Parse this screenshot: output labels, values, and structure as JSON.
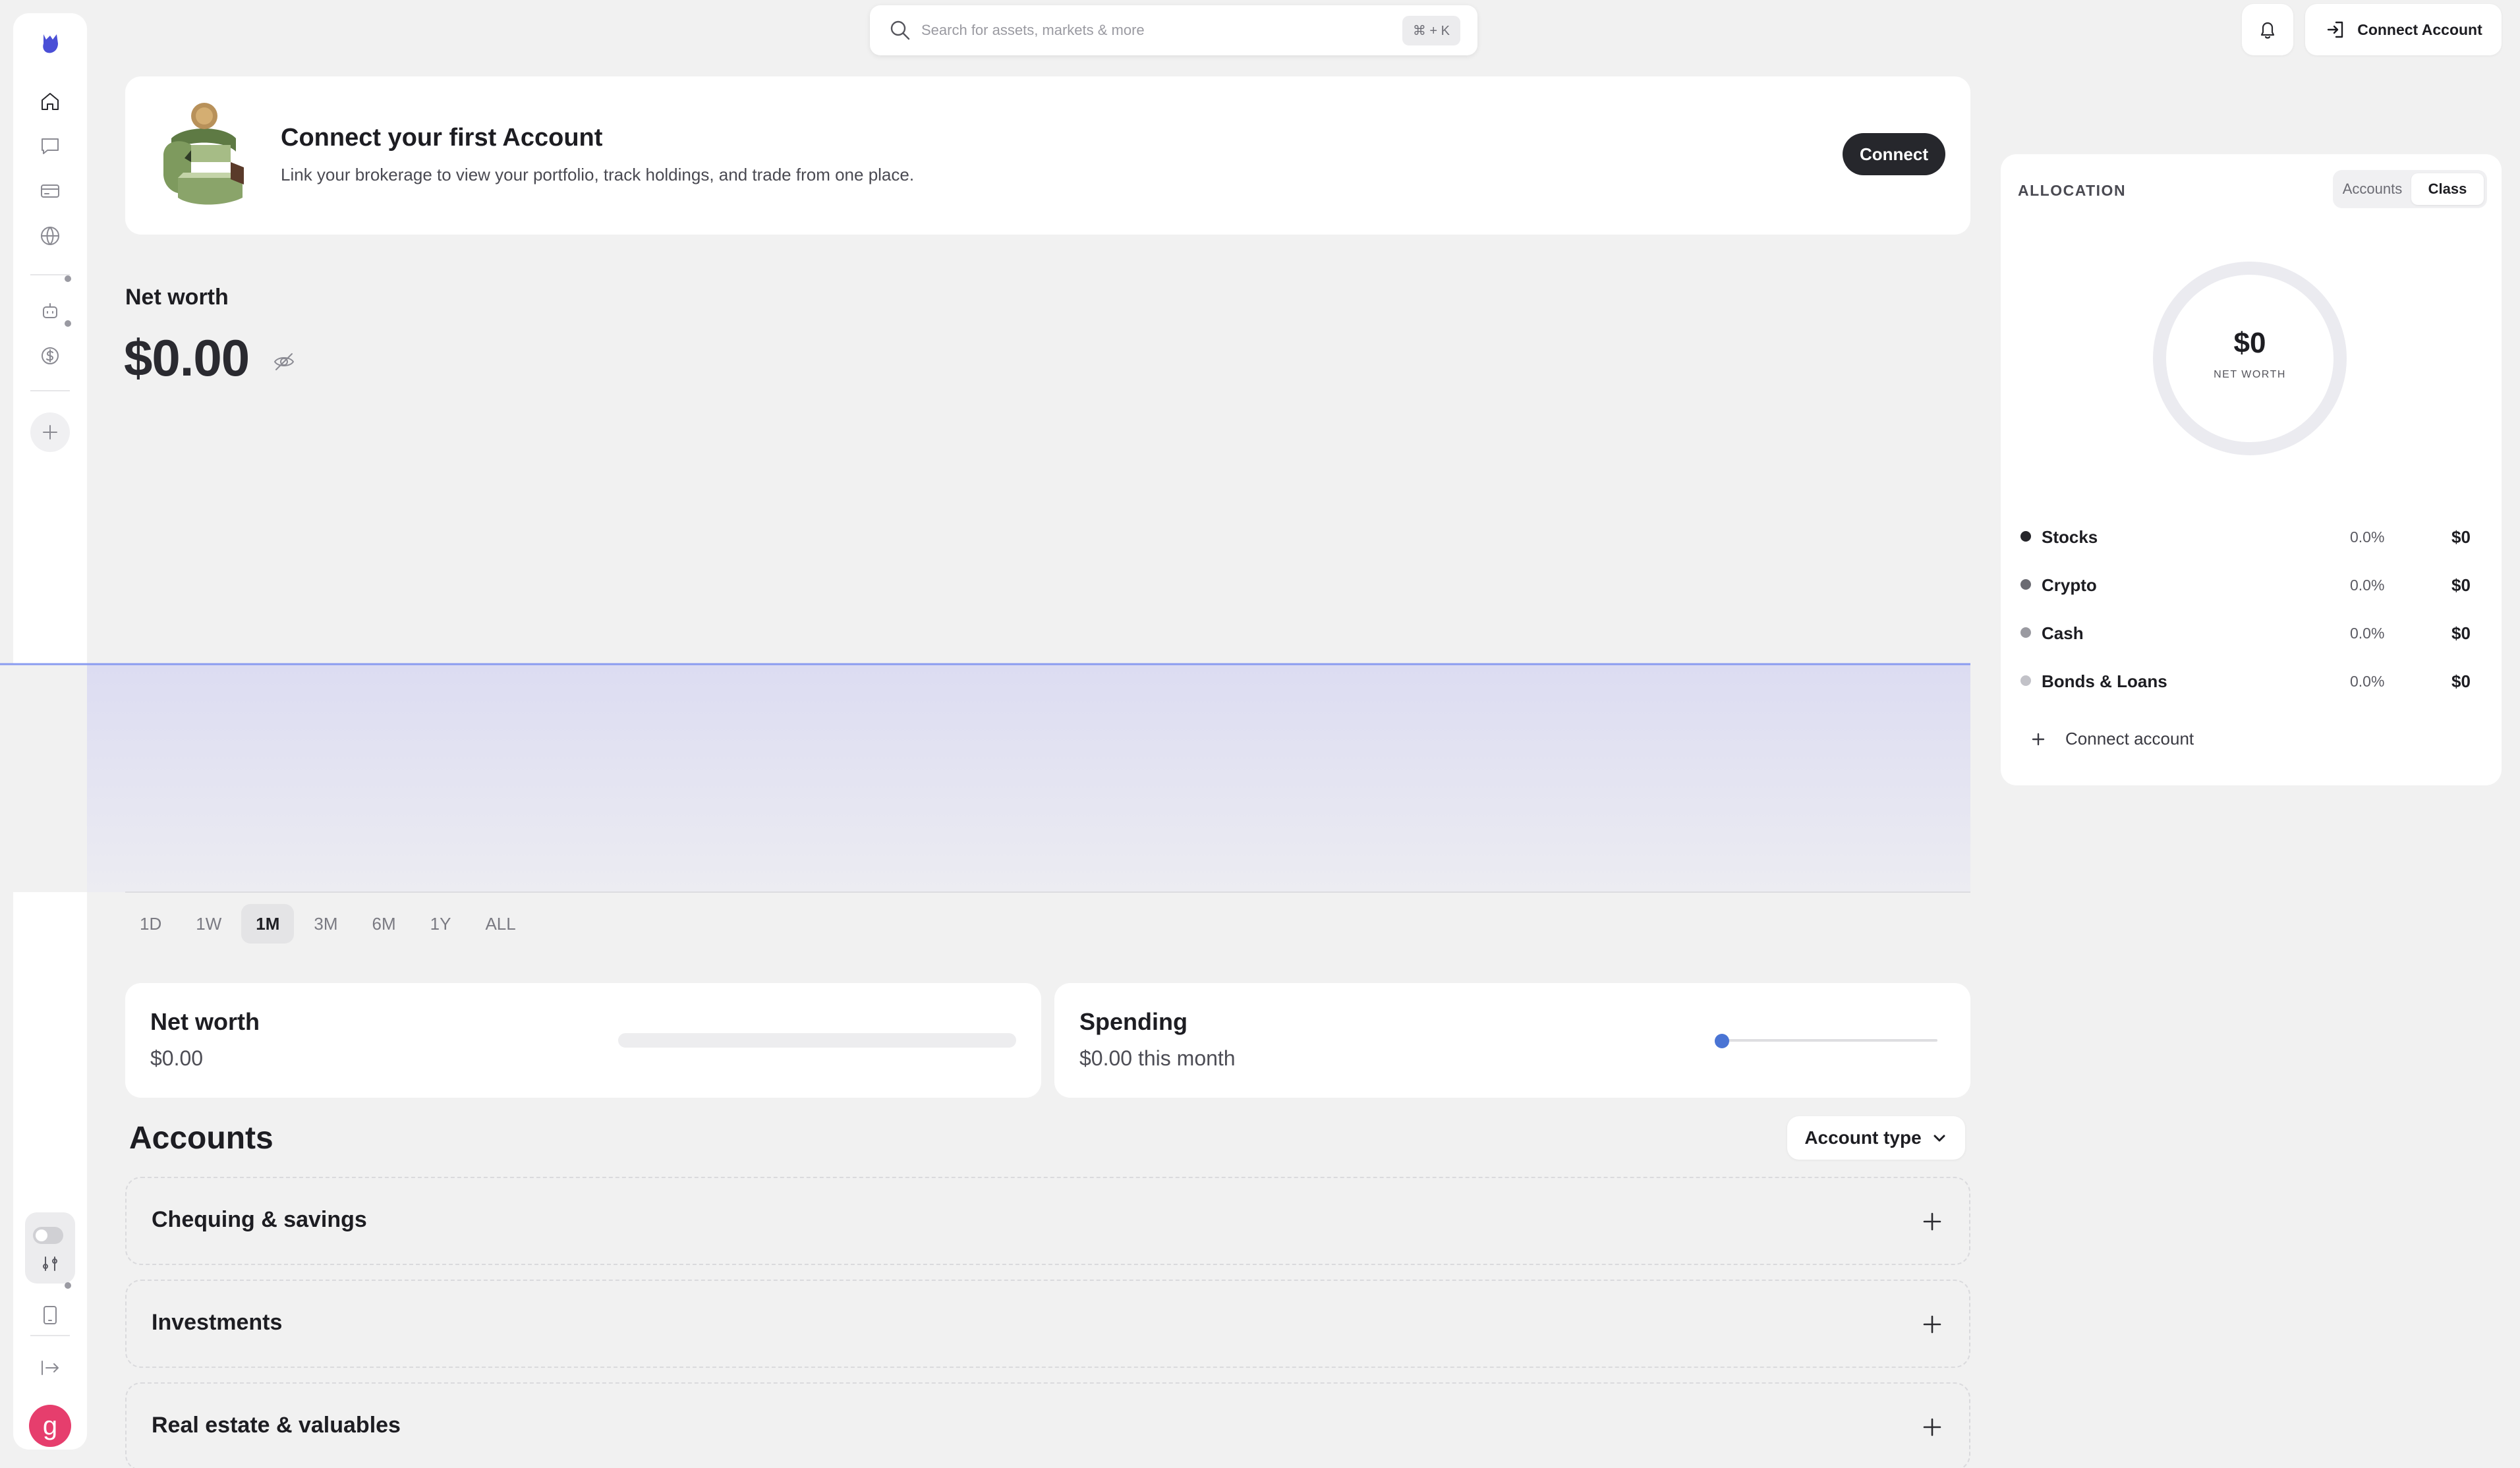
{
  "sidebar": {
    "icons": [
      "logo-icon",
      "home-icon",
      "chat-icon",
      "card-icon",
      "globe-icon",
      "bot-icon",
      "dollar-icon",
      "add-icon",
      "theme-toggle",
      "sliders-icon",
      "tablet-icon",
      "logout-icon"
    ],
    "avatar_letter": "g",
    "avatar_color": "#e63e6d"
  },
  "topbar": {
    "search_placeholder": "Search for assets, markets & more",
    "search_shortcut": "⌘ + K",
    "connect_label": "Connect Account"
  },
  "banner": {
    "title": "Connect your first Account",
    "description": "Link your brokerage to view your portfolio, track holdings, and trade from one place.",
    "button": "Connect"
  },
  "networth": {
    "label": "Net worth",
    "value": "$0.00",
    "line_color": "#8a9cf0"
  },
  "ranges": [
    {
      "label": "1D",
      "active": false
    },
    {
      "label": "1W",
      "active": false
    },
    {
      "label": "1M",
      "active": true
    },
    {
      "label": "3M",
      "active": false
    },
    {
      "label": "6M",
      "active": false
    },
    {
      "label": "1Y",
      "active": false
    },
    {
      "label": "ALL",
      "active": false
    }
  ],
  "cards": {
    "networth": {
      "title": "Net worth",
      "value": "$0.00",
      "bar_fill": 0
    },
    "spending": {
      "title": "Spending",
      "value": "$0.00 this month",
      "slider_position": 0
    }
  },
  "accounts": {
    "title": "Accounts",
    "filter_label": "Account type",
    "groups": [
      "Chequing & savings",
      "Investments",
      "Real estate & valuables"
    ]
  },
  "allocation": {
    "title": "ALLOCATION",
    "tabs": [
      {
        "label": "Accounts",
        "active": false
      },
      {
        "label": "Class",
        "active": true
      }
    ],
    "total": "$0",
    "total_label": "NET WORTH",
    "rows": [
      {
        "name": "Stocks",
        "pct": "0.0%",
        "amount": "$0",
        "color": "#26262b"
      },
      {
        "name": "Crypto",
        "pct": "0.0%",
        "amount": "$0",
        "color": "#6b6b72"
      },
      {
        "name": "Cash",
        "pct": "0.0%",
        "amount": "$0",
        "color": "#9a9aa1"
      },
      {
        "name": "Bonds & Loans",
        "pct": "0.0%",
        "amount": "$0",
        "color": "#c2c2c8"
      }
    ],
    "connect_label": "Connect account"
  }
}
